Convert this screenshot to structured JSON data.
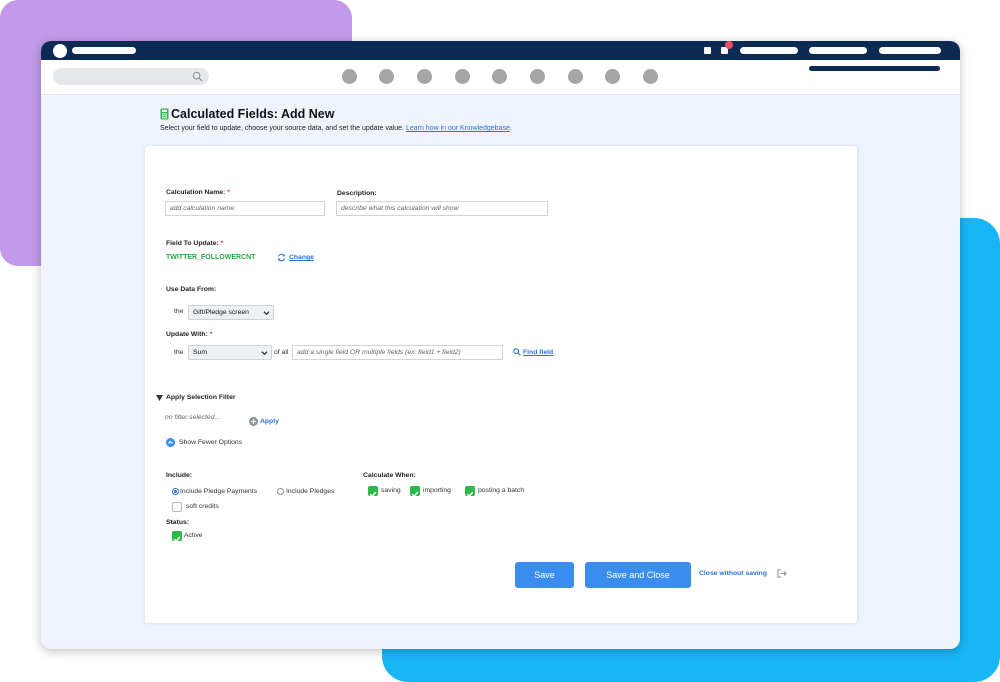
{
  "header": {
    "title": "Calculated Fields: Add New",
    "subtitle": "Select your field to update, choose your source data, and set the update value.",
    "help_link": "Learn how in our Knowledgebase",
    "help_link_suffix": "."
  },
  "form": {
    "calc_name": {
      "label": "Calculation Name:",
      "required_mark": "*",
      "placeholder": "add calculation name"
    },
    "description": {
      "label": "Description:",
      "placeholder": "describe what this calculation will show"
    },
    "field_to_update": {
      "label": "Field To Update:",
      "required_mark": "*",
      "value": "TWITTER_FOLLOWERCNT",
      "change_label": "Change"
    },
    "use_data_from": {
      "label": "Use Data From:",
      "prefix": "the",
      "selected": "Gift/Pledge screen"
    },
    "update_with": {
      "label": "Update With:",
      "required_mark": "*",
      "prefix": "the",
      "selected": "Sum",
      "of_all": "of all",
      "placeholder": "add a single field OR multiple fields (ex: field1 + field2)",
      "find_label": "Find field"
    },
    "selection_filter": {
      "label": "Apply Selection Filter",
      "no_filter": "no filter selected...",
      "apply_label": "Apply",
      "fewer_label": "Show Fewer Options"
    },
    "include": {
      "label": "Include:",
      "options": [
        {
          "label": "Include Pledge Payments",
          "selected": true
        },
        {
          "label": "Include Pledges",
          "selected": false
        }
      ],
      "soft_credits": {
        "label": "soft credits",
        "checked": false
      }
    },
    "calculate_when": {
      "label": "Calculate When:",
      "options": [
        {
          "label": "saving",
          "checked": true
        },
        {
          "label": "importing",
          "checked": true
        },
        {
          "label": "posting a batch",
          "checked": true
        }
      ]
    },
    "status": {
      "label": "Status:",
      "active_label": "Active",
      "checked": true
    }
  },
  "actions": {
    "save": "Save",
    "save_close": "Save and Close",
    "close_without_saving": "Close without saving"
  },
  "colors": {
    "topbar": "#0b2a54",
    "accent": "#3b8ef0",
    "link": "#2a72d8",
    "success": "#28a745",
    "required": "#e0344a",
    "purple_blob": "#c39ae9",
    "blue_blob": "#19b6f5"
  }
}
